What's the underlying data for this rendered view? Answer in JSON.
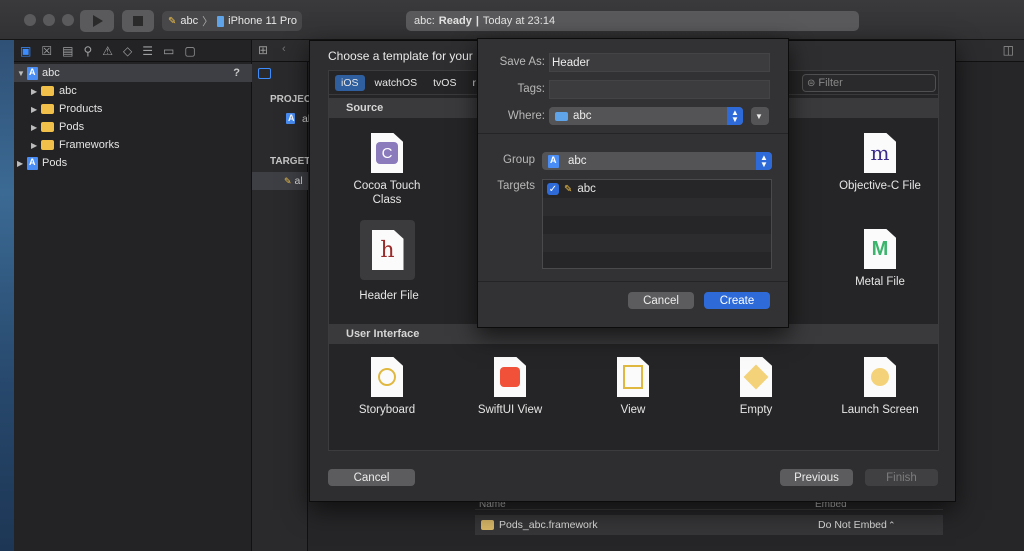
{
  "toolbar": {
    "scheme_target": "abc",
    "device": "iPhone 11 Pro",
    "activity_project": "abc:",
    "activity_status": "Ready",
    "activity_separator": "|",
    "activity_time": "Today at 23:14"
  },
  "navigator": {
    "items": [
      {
        "label": "abc",
        "badge": "?"
      },
      {
        "label": "abc"
      },
      {
        "label": "Products"
      },
      {
        "label": "Pods"
      },
      {
        "label": "Frameworks"
      },
      {
        "label": "Pods"
      }
    ]
  },
  "editor": {
    "project_header": "PROJEC",
    "targets_header": "TARGET",
    "project_item": "al",
    "target_item": "al"
  },
  "template_sheet": {
    "title": "Choose a template for your",
    "platforms": [
      "iOS",
      "watchOS",
      "tvOS",
      "r"
    ],
    "filter_placeholder": "Filter",
    "source_header": "Source",
    "ui_header": "User Interface",
    "source_templates": [
      {
        "name": "Cocoa Touch Class",
        "glyph": "C"
      },
      {
        "name": "Header File",
        "glyph": "h"
      },
      {
        "name": "Objective-C File",
        "glyph": "m"
      },
      {
        "name": "Metal File",
        "glyph": "M"
      }
    ],
    "ui_templates": [
      {
        "name": "Storyboard"
      },
      {
        "name": "SwiftUI View"
      },
      {
        "name": "View"
      },
      {
        "name": "Empty"
      },
      {
        "name": "Launch Screen"
      }
    ],
    "cancel_label": "Cancel",
    "previous_label": "Previous",
    "finish_label": "Finish"
  },
  "save_panel": {
    "save_as_label": "Save As:",
    "save_as_value": "Header",
    "tags_label": "Tags:",
    "tags_value": "",
    "where_label": "Where:",
    "where_value": "abc",
    "group_label": "Group",
    "group_value": "abc",
    "targets_label": "Targets",
    "targets": [
      {
        "name": "abc",
        "checked": true
      }
    ],
    "cancel_label": "Cancel",
    "create_label": "Create"
  },
  "frameworks_table": {
    "col_name": "Name",
    "col_embed": "Embed",
    "row_name": "Pods_abc.framework",
    "row_embed": "Do Not Embed"
  },
  "colors": {
    "accent": "#2f6bd8",
    "platform_selected": "#2f5f9e",
    "folder": "#f0c04a"
  }
}
